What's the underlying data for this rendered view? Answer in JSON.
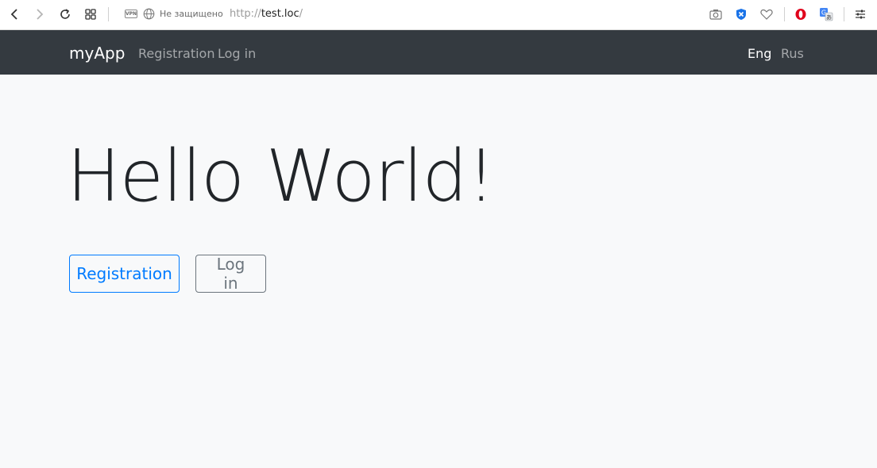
{
  "browser": {
    "security_status": "Не защищено",
    "url_scheme": "http://",
    "url_host": "test.loc",
    "url_suffix": "/",
    "vpn_label": "VPN",
    "icons": [
      "back-arrow-icon",
      "forward-arrow-icon",
      "reload-icon",
      "tabs-grid-icon",
      "vpn-icon",
      "globe-icon",
      "camera-icon",
      "shield-icon",
      "heart-icon",
      "opera-icon",
      "translate-icon",
      "settings-sliders-icon"
    ]
  },
  "navbar": {
    "brand": "myApp",
    "links": [
      "Registration",
      "Log in"
    ],
    "languages": [
      {
        "label": "Eng",
        "active": true
      },
      {
        "label": "Rus",
        "active": false
      }
    ],
    "background": "#343a40"
  },
  "main": {
    "title": "Hello World!",
    "buttons": {
      "registration": "Registration",
      "login": "Log in"
    }
  },
  "colors": {
    "primary": "#007bff",
    "secondary": "#6c757d",
    "page_bg": "#f8f9fa"
  }
}
